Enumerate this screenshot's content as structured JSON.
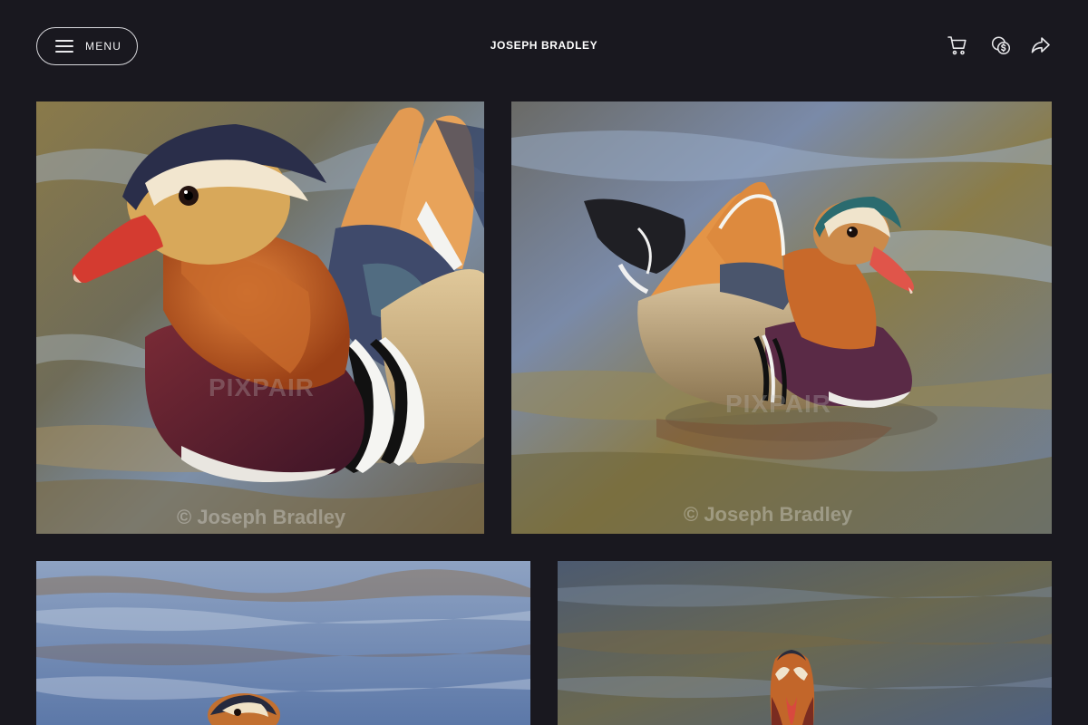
{
  "header": {
    "menu_label": "MENU",
    "site_title": "JOSEPH BRADLEY",
    "icons": [
      "cart-icon",
      "currency-icon",
      "share-icon"
    ]
  },
  "gallery": {
    "photos": [
      {
        "subject": "mandarin-duck-closeup",
        "watermark_logo": "PIXPAIR",
        "watermark_text": "© Joseph Bradley"
      },
      {
        "subject": "mandarin-duck-swimming",
        "watermark_logo": "PIXPAIR",
        "watermark_text": "© Joseph Bradley"
      },
      {
        "subject": "mandarin-duck-distant"
      },
      {
        "subject": "mandarin-duck-front"
      }
    ]
  },
  "colors": {
    "background": "#19181f",
    "text": "#ffffff",
    "border": "#d8d8dc"
  }
}
